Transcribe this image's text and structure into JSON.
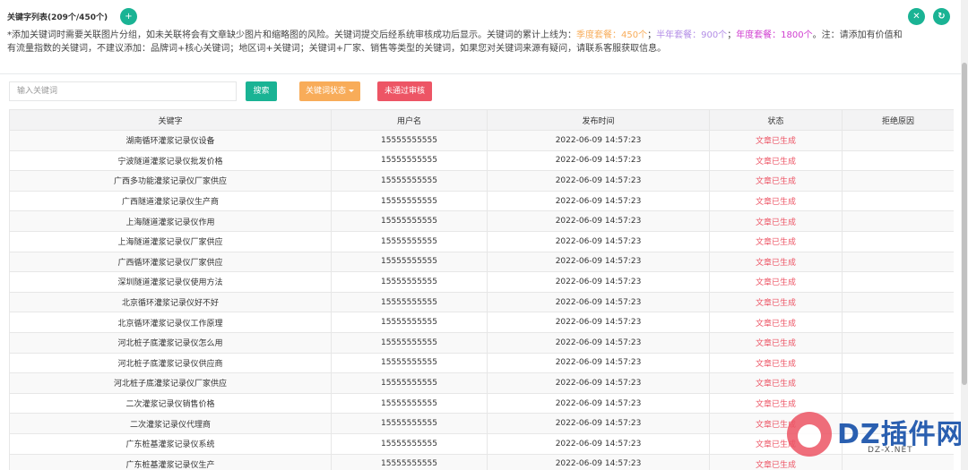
{
  "header": {
    "title": "关键字列表(209个/450个)",
    "notice_part1": "*添加关键词时需要关联图片分组，如未关联将会有文章缺少图片和缩略图的风险。关键词提交后经系统审核成功后显示。关键词的累计上线为：",
    "plan_quarter": "季度套餐：450个",
    "sep1": "；",
    "plan_half": "半年套餐：900个",
    "sep2": "；",
    "plan_year": "年度套餐：1800个",
    "notice_part2": "。注：请添加有价值和有流量指数的关键词，不建议添加：品牌词+核心关键词；地区词+关键词；关键词+厂家、销售等类型的关键词，如果您对关键词来源有疑问，请联系客服获取信息。",
    "colors": {
      "quarter": "#f8ac59",
      "half": "#b38ee6",
      "year": "#d03fd0"
    },
    "icons": {
      "add": "add-user-icon",
      "close": "close-icon",
      "refresh": "refresh-icon"
    }
  },
  "toolbar": {
    "search_placeholder": "输入关键词",
    "search_label": "搜索",
    "status_label": "关键词状态",
    "reject_label": "未通过审核"
  },
  "table": {
    "columns": [
      "关键字",
      "用户名",
      "发布时间",
      "状态",
      "拒绝原因"
    ],
    "rows": [
      {
        "keyword": "湖南循环灌浆记录仪设备",
        "user": "15555555555",
        "time": "2022-06-09 14:57:23",
        "status": "文章已生成",
        "reason": ""
      },
      {
        "keyword": "宁波隧道灌浆记录仪批发价格",
        "user": "15555555555",
        "time": "2022-06-09 14:57:23",
        "status": "文章已生成",
        "reason": ""
      },
      {
        "keyword": "广西多功能灌浆记录仪厂家供应",
        "user": "15555555555",
        "time": "2022-06-09 14:57:23",
        "status": "文章已生成",
        "reason": ""
      },
      {
        "keyword": "广西隧道灌浆记录仪生产商",
        "user": "15555555555",
        "time": "2022-06-09 14:57:23",
        "status": "文章已生成",
        "reason": ""
      },
      {
        "keyword": "上海隧道灌浆记录仪作用",
        "user": "15555555555",
        "time": "2022-06-09 14:57:23",
        "status": "文章已生成",
        "reason": ""
      },
      {
        "keyword": "上海隧道灌浆记录仪厂家供应",
        "user": "15555555555",
        "time": "2022-06-09 14:57:23",
        "status": "文章已生成",
        "reason": ""
      },
      {
        "keyword": "广西循环灌浆记录仪厂家供应",
        "user": "15555555555",
        "time": "2022-06-09 14:57:23",
        "status": "文章已生成",
        "reason": ""
      },
      {
        "keyword": "深圳隧道灌浆记录仪使用方法",
        "user": "15555555555",
        "time": "2022-06-09 14:57:23",
        "status": "文章已生成",
        "reason": ""
      },
      {
        "keyword": "北京循环灌浆记录仪好不好",
        "user": "15555555555",
        "time": "2022-06-09 14:57:23",
        "status": "文章已生成",
        "reason": ""
      },
      {
        "keyword": "北京循环灌浆记录仪工作原理",
        "user": "15555555555",
        "time": "2022-06-09 14:57:23",
        "status": "文章已生成",
        "reason": ""
      },
      {
        "keyword": "河北桩子底灌浆记录仪怎么用",
        "user": "15555555555",
        "time": "2022-06-09 14:57:23",
        "status": "文章已生成",
        "reason": ""
      },
      {
        "keyword": "河北桩子底灌浆记录仪供应商",
        "user": "15555555555",
        "time": "2022-06-09 14:57:23",
        "status": "文章已生成",
        "reason": ""
      },
      {
        "keyword": "河北桩子底灌浆记录仪厂家供应",
        "user": "15555555555",
        "time": "2022-06-09 14:57:23",
        "status": "文章已生成",
        "reason": ""
      },
      {
        "keyword": "二次灌浆记录仪销售价格",
        "user": "15555555555",
        "time": "2022-06-09 14:57:23",
        "status": "文章已生成",
        "reason": ""
      },
      {
        "keyword": "二次灌浆记录仪代理商",
        "user": "15555555555",
        "time": "2022-06-09 14:57:23",
        "status": "文章已生成",
        "reason": ""
      },
      {
        "keyword": "广东桩基灌浆记录仪系统",
        "user": "15555555555",
        "time": "2022-06-09 14:57:23",
        "status": "文章已生成",
        "reason": ""
      },
      {
        "keyword": "广东桩基灌浆记录仪生产",
        "user": "15555555555",
        "time": "2022-06-09 14:57:23",
        "status": "文章已生成",
        "reason": ""
      }
    ]
  },
  "watermark": {
    "logo": "DZ插件网",
    "sub": "DZ-X.NET"
  }
}
